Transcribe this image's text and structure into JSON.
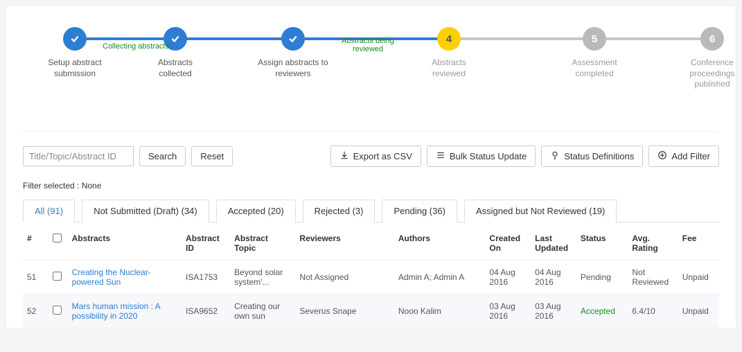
{
  "stepper": {
    "steps": [
      {
        "label": "Setup abstract submission",
        "state": "done"
      },
      {
        "label": "Abstracts collected",
        "state": "done"
      },
      {
        "label": "Assign abstracts to reviewers",
        "state": "done"
      },
      {
        "label": "Abstracts reviewed",
        "state": "current",
        "num": "4"
      },
      {
        "label": "Assessment completed",
        "state": "future",
        "num": "5"
      },
      {
        "label": "Conference proceedings published",
        "state": "future",
        "num": "6"
      }
    ],
    "captions": [
      "Collecting abstracts",
      "Abstracts being reviewed"
    ]
  },
  "toolbar": {
    "search_placeholder": "Title/Topic/Abstract ID",
    "search_btn": "Search",
    "reset_btn": "Reset",
    "export_btn": "Export as CSV",
    "bulk_btn": "Bulk Status Update",
    "status_def_btn": "Status Definitions",
    "add_filter_btn": "Add Filter"
  },
  "filter_line_label": "Filter selected :",
  "filter_line_value": "None",
  "tabs": {
    "all": "All (91)",
    "not_submitted": "Not Submitted (Draft) (34)",
    "accepted": "Accepted (20)",
    "rejected": "Rejected (3)",
    "pending": "Pending (36)",
    "assigned": "Assigned but Not Reviewed (19)"
  },
  "table": {
    "headers": {
      "row": "#",
      "abstracts": "Abstracts",
      "abstract_id": "Abstract ID",
      "topic": "Abstract Topic",
      "reviewers": "Reviewers",
      "authors": "Authors",
      "created": "Created On",
      "updated": "Last Updated",
      "status": "Status",
      "rating": "Avg. Rating",
      "fee": "Fee"
    },
    "rows": [
      {
        "num": "51",
        "title": "Creating the Nuclear-powered Sun",
        "abstract_id": "ISA1753",
        "topic": "Beyond solar system'...",
        "reviewers": "Not Assigned",
        "authors": "Admin A; Admin A",
        "created": "04 Aug 2016",
        "updated": "04 Aug 2016",
        "status": "Pending",
        "status_class": "",
        "rating": "Not Reviewed",
        "fee": "Unpaid"
      },
      {
        "num": "52",
        "title": "Mars human mission : A possibility in 2020",
        "abstract_id": "ISA9652",
        "topic": "Creating our own sun",
        "reviewers": "Severus Snape",
        "authors": "Nooo Kalim",
        "created": "03 Aug 2016",
        "updated": "03 Aug 2016",
        "status": "Accepted",
        "status_class": "accepted",
        "rating": "6.4/10",
        "fee": "Unpaid"
      }
    ]
  }
}
